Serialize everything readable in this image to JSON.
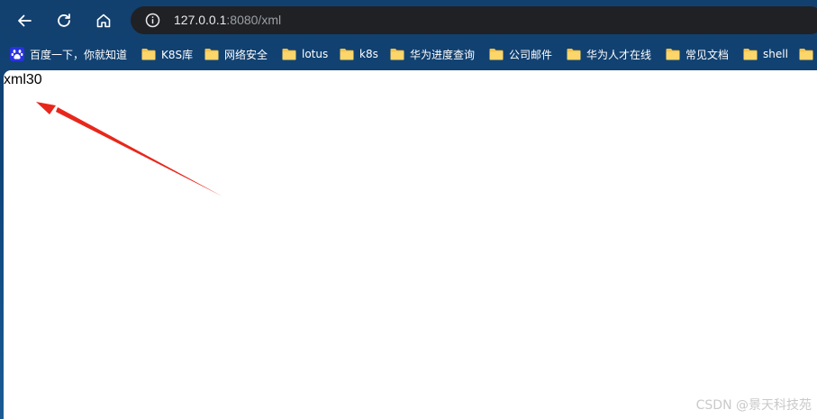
{
  "browser": {
    "nav": {
      "back_icon": "arrow-left-icon",
      "reload_icon": "reload-icon",
      "home_icon": "home-icon"
    },
    "address": {
      "info_icon": "info-icon",
      "host": "127.0.0.1",
      "rest": ":8080/xml"
    }
  },
  "bookmarks": {
    "items": [
      {
        "label": "百度一下，你就知道",
        "icon": "baidu-paw-icon"
      },
      {
        "label": "K8S库",
        "icon": "folder-icon"
      },
      {
        "label": "网络安全",
        "icon": "folder-icon"
      },
      {
        "label": "lotus",
        "icon": "folder-icon"
      },
      {
        "label": "k8s",
        "icon": "folder-icon"
      },
      {
        "label": "华为进度查询",
        "icon": "folder-icon"
      },
      {
        "label": "公司邮件",
        "icon": "folder-icon"
      },
      {
        "label": "华为人才在线",
        "icon": "folder-icon"
      },
      {
        "label": "常见文档",
        "icon": "folder-icon"
      },
      {
        "label": "shell",
        "icon": "folder-icon"
      },
      {
        "label": "",
        "icon": "folder-icon"
      }
    ]
  },
  "page": {
    "body_text": "xml30",
    "annotation_icon": "red-arrow-annotation-icon",
    "watermark": "CSDN @景天科技苑"
  },
  "colors": {
    "frame_bg": "#12406e",
    "address_bar_bg": "#202124",
    "folder_yellow": "#f6c34a",
    "arrow_red": "#e8271c",
    "watermark_gray": "#c9c9c9"
  }
}
